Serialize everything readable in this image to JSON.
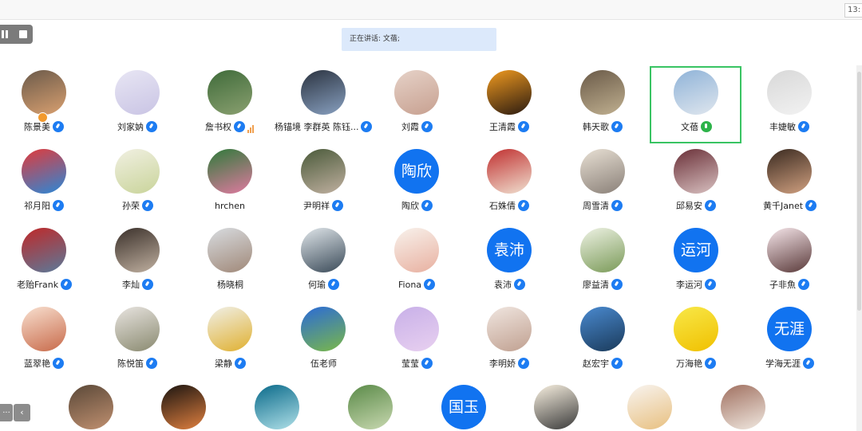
{
  "window": {
    "clock": "13:"
  },
  "controls": {
    "pause_icon": "pause-icon",
    "stop_icon": "stop-icon"
  },
  "banner": {
    "speaking_text": "正在讲话: 文蓓;"
  },
  "pager": {
    "more_label": "...",
    "prev_label": "‹"
  },
  "participants": [
    {
      "name": "陈景美",
      "avatar": "photo",
      "colors": [
        "#6b5a4a",
        "#d9a070"
      ],
      "mic": "muted",
      "badge": true
    },
    {
      "name": "刘家妠",
      "avatar": "photo",
      "colors": [
        "#e8e6f4",
        "#c9c4e4"
      ],
      "mic": "muted"
    },
    {
      "name": "詹书权",
      "avatar": "photo",
      "colors": [
        "#3f6b3a",
        "#8aa070"
      ],
      "mic": "muted",
      "level": true
    },
    {
      "name": "杨锚境 李群英 陈钰...",
      "avatar": "photo",
      "colors": [
        "#2b3340",
        "#88a0c0"
      ],
      "mic": "muted"
    },
    {
      "name": "刘霞",
      "avatar": "photo",
      "colors": [
        "#e6d2c8",
        "#c7a090"
      ],
      "mic": "muted"
    },
    {
      "name": "王清霞",
      "avatar": "photo",
      "colors": [
        "#f09a20",
        "#2a1a10"
      ],
      "mic": "muted"
    },
    {
      "name": "韩天歌",
      "avatar": "photo",
      "colors": [
        "#6a5a48",
        "#c0b090"
      ],
      "mic": "muted"
    },
    {
      "name": "文蓓",
      "avatar": "photo",
      "colors": [
        "#8fb3d8",
        "#dfe6ee"
      ],
      "mic": "speaking"
    },
    {
      "name": "丰婕敏",
      "avatar": "photo",
      "colors": [
        "#d8d8d8",
        "#f2f2f2"
      ],
      "mic": "muted"
    },
    {
      "name": "祁月阳",
      "avatar": "photo",
      "colors": [
        "#e23a3a",
        "#2a88d8"
      ],
      "mic": "muted"
    },
    {
      "name": "孙荣",
      "avatar": "photo",
      "colors": [
        "#f1f0e2",
        "#c9d49a"
      ],
      "mic": "muted"
    },
    {
      "name": "hrchen",
      "avatar": "photo",
      "colors": [
        "#2f7a3a",
        "#e07aa0"
      ],
      "mic": "none"
    },
    {
      "name": "尹明祥",
      "avatar": "photo",
      "colors": [
        "#4a5a3a",
        "#c0b0a0"
      ],
      "mic": "muted"
    },
    {
      "name": "陶欣",
      "avatar": "text",
      "label": "陶欣",
      "mic": "muted"
    },
    {
      "name": "石姝倩",
      "avatar": "photo",
      "colors": [
        "#c03030",
        "#f0e0d0"
      ],
      "mic": "muted"
    },
    {
      "name": "周雪清",
      "avatar": "photo",
      "colors": [
        "#e8e0d4",
        "#8a8078"
      ],
      "mic": "muted"
    },
    {
      "name": "邱易安",
      "avatar": "photo",
      "colors": [
        "#6a3038",
        "#d8c0c0"
      ],
      "mic": "muted"
    },
    {
      "name": "黄千Janet",
      "avatar": "photo",
      "colors": [
        "#3a2a20",
        "#d0a080"
      ],
      "mic": "muted"
    },
    {
      "name": "老贻Frank",
      "avatar": "photo",
      "colors": [
        "#c02828",
        "#5a7a9a"
      ],
      "mic": "muted"
    },
    {
      "name": "李灿",
      "avatar": "photo",
      "colors": [
        "#3a302a",
        "#c0b0a0"
      ],
      "mic": "muted"
    },
    {
      "name": "杨晓桐",
      "avatar": "photo",
      "colors": [
        "#d8dce0",
        "#a08878"
      ],
      "mic": "none"
    },
    {
      "name": "何瑜",
      "avatar": "photo",
      "colors": [
        "#e0e6ea",
        "#3a4a58"
      ],
      "mic": "muted"
    },
    {
      "name": "Fiona",
      "avatar": "photo",
      "colors": [
        "#f8f2ec",
        "#e8b0a0"
      ],
      "mic": "muted"
    },
    {
      "name": "袁沛",
      "avatar": "text",
      "label": "袁沛",
      "mic": "muted"
    },
    {
      "name": "廖益清",
      "avatar": "photo",
      "colors": [
        "#eef2e4",
        "#7a9a58"
      ],
      "mic": "muted"
    },
    {
      "name": "李运河",
      "avatar": "text",
      "label": "运河",
      "mic": "muted"
    },
    {
      "name": "子非魚",
      "avatar": "photo",
      "colors": [
        "#f6e6ea",
        "#5a3a3a"
      ],
      "mic": "muted"
    },
    {
      "name": "蓝翠艳",
      "avatar": "photo",
      "colors": [
        "#f8e0d0",
        "#c86a4a"
      ],
      "mic": "muted"
    },
    {
      "name": "陈悦笛",
      "avatar": "photo",
      "colors": [
        "#e8e4e0",
        "#8a8a70"
      ],
      "mic": "muted"
    },
    {
      "name": "梁静",
      "avatar": "photo",
      "colors": [
        "#f0f0e8",
        "#e0b030"
      ],
      "mic": "muted"
    },
    {
      "name": "伍老师",
      "avatar": "photo",
      "colors": [
        "#2a6ad8",
        "#7ab848"
      ],
      "mic": "none"
    },
    {
      "name": "莹莹",
      "avatar": "photo",
      "colors": [
        "#c8b0e8",
        "#e8d0f0"
      ],
      "mic": "muted"
    },
    {
      "name": "李明娇",
      "avatar": "photo",
      "colors": [
        "#f0e6e0",
        "#c0a090"
      ],
      "mic": "muted"
    },
    {
      "name": "赵宏宇",
      "avatar": "photo",
      "colors": [
        "#4a8ad0",
        "#1a3a5a"
      ],
      "mic": "muted"
    },
    {
      "name": "万海艳",
      "avatar": "photo",
      "colors": [
        "#f8e848",
        "#f0c000"
      ],
      "mic": "muted"
    },
    {
      "name": "学海无涯",
      "avatar": "text",
      "label": "无涯",
      "mic": "muted"
    },
    {
      "name": "",
      "avatar": "photo",
      "colors": [
        "#5a4838",
        "#c09070"
      ],
      "mic": "none"
    },
    {
      "name": "",
      "avatar": "photo",
      "colors": [
        "#1a1410",
        "#e08040"
      ],
      "mic": "none"
    },
    {
      "name": "",
      "avatar": "photo",
      "colors": [
        "#0a6a8a",
        "#b0e0e8"
      ],
      "mic": "none"
    },
    {
      "name": "",
      "avatar": "photo",
      "colors": [
        "#5a8a48",
        "#c8d8b0"
      ],
      "mic": "none"
    },
    {
      "name": "",
      "avatar": "text",
      "label": "国玉",
      "mic": "none"
    },
    {
      "name": "",
      "avatar": "photo",
      "colors": [
        "#f8f0e0",
        "#3a3a3a"
      ],
      "mic": "none"
    },
    {
      "name": "",
      "avatar": "photo",
      "colors": [
        "#f8f4f0",
        "#e8c080"
      ],
      "mic": "none"
    },
    {
      "name": "",
      "avatar": "photo",
      "colors": [
        "#a07060",
        "#f0e8e0"
      ],
      "mic": "none"
    }
  ]
}
